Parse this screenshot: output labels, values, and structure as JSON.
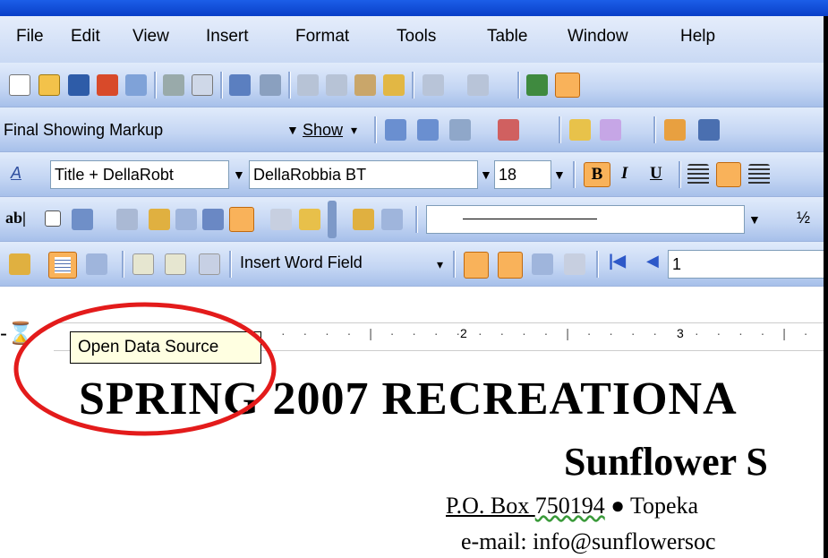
{
  "menu": [
    "File",
    "Edit",
    "View",
    "Insert",
    "Format",
    "Tools",
    "Table",
    "Window",
    "Help"
  ],
  "reviewing": {
    "display_mode": "Final Showing Markup",
    "show_label": "Show"
  },
  "formatting": {
    "style": "Title + DellaRobt",
    "font": "DellaRobbia BT",
    "size": "18",
    "bold": "B",
    "italic": "I",
    "underline": "U"
  },
  "forms": {
    "text_field": "ab|",
    "fraction": "½"
  },
  "mailmerge": {
    "insert_word_field": "Insert Word Field",
    "record": "1"
  },
  "tooltip": "Open Data Source",
  "ruler": {
    "mark2": "2",
    "mark3": "3"
  },
  "document": {
    "title": "SPRING 2007 RECREATIONA",
    "subtitle": "Sunflower S",
    "address_po": "P.O. Box ",
    "address_num": "750194",
    "address_sep": "  ●  ",
    "address_city": "Topeka",
    "email": "e-mail:  info@sunflowersoc"
  },
  "colors": {
    "menu_bg": "#d6e2f8",
    "highlight": "#f9b25a",
    "circle": "#e31b1b",
    "tooltip_bg": "#ffffe1"
  }
}
